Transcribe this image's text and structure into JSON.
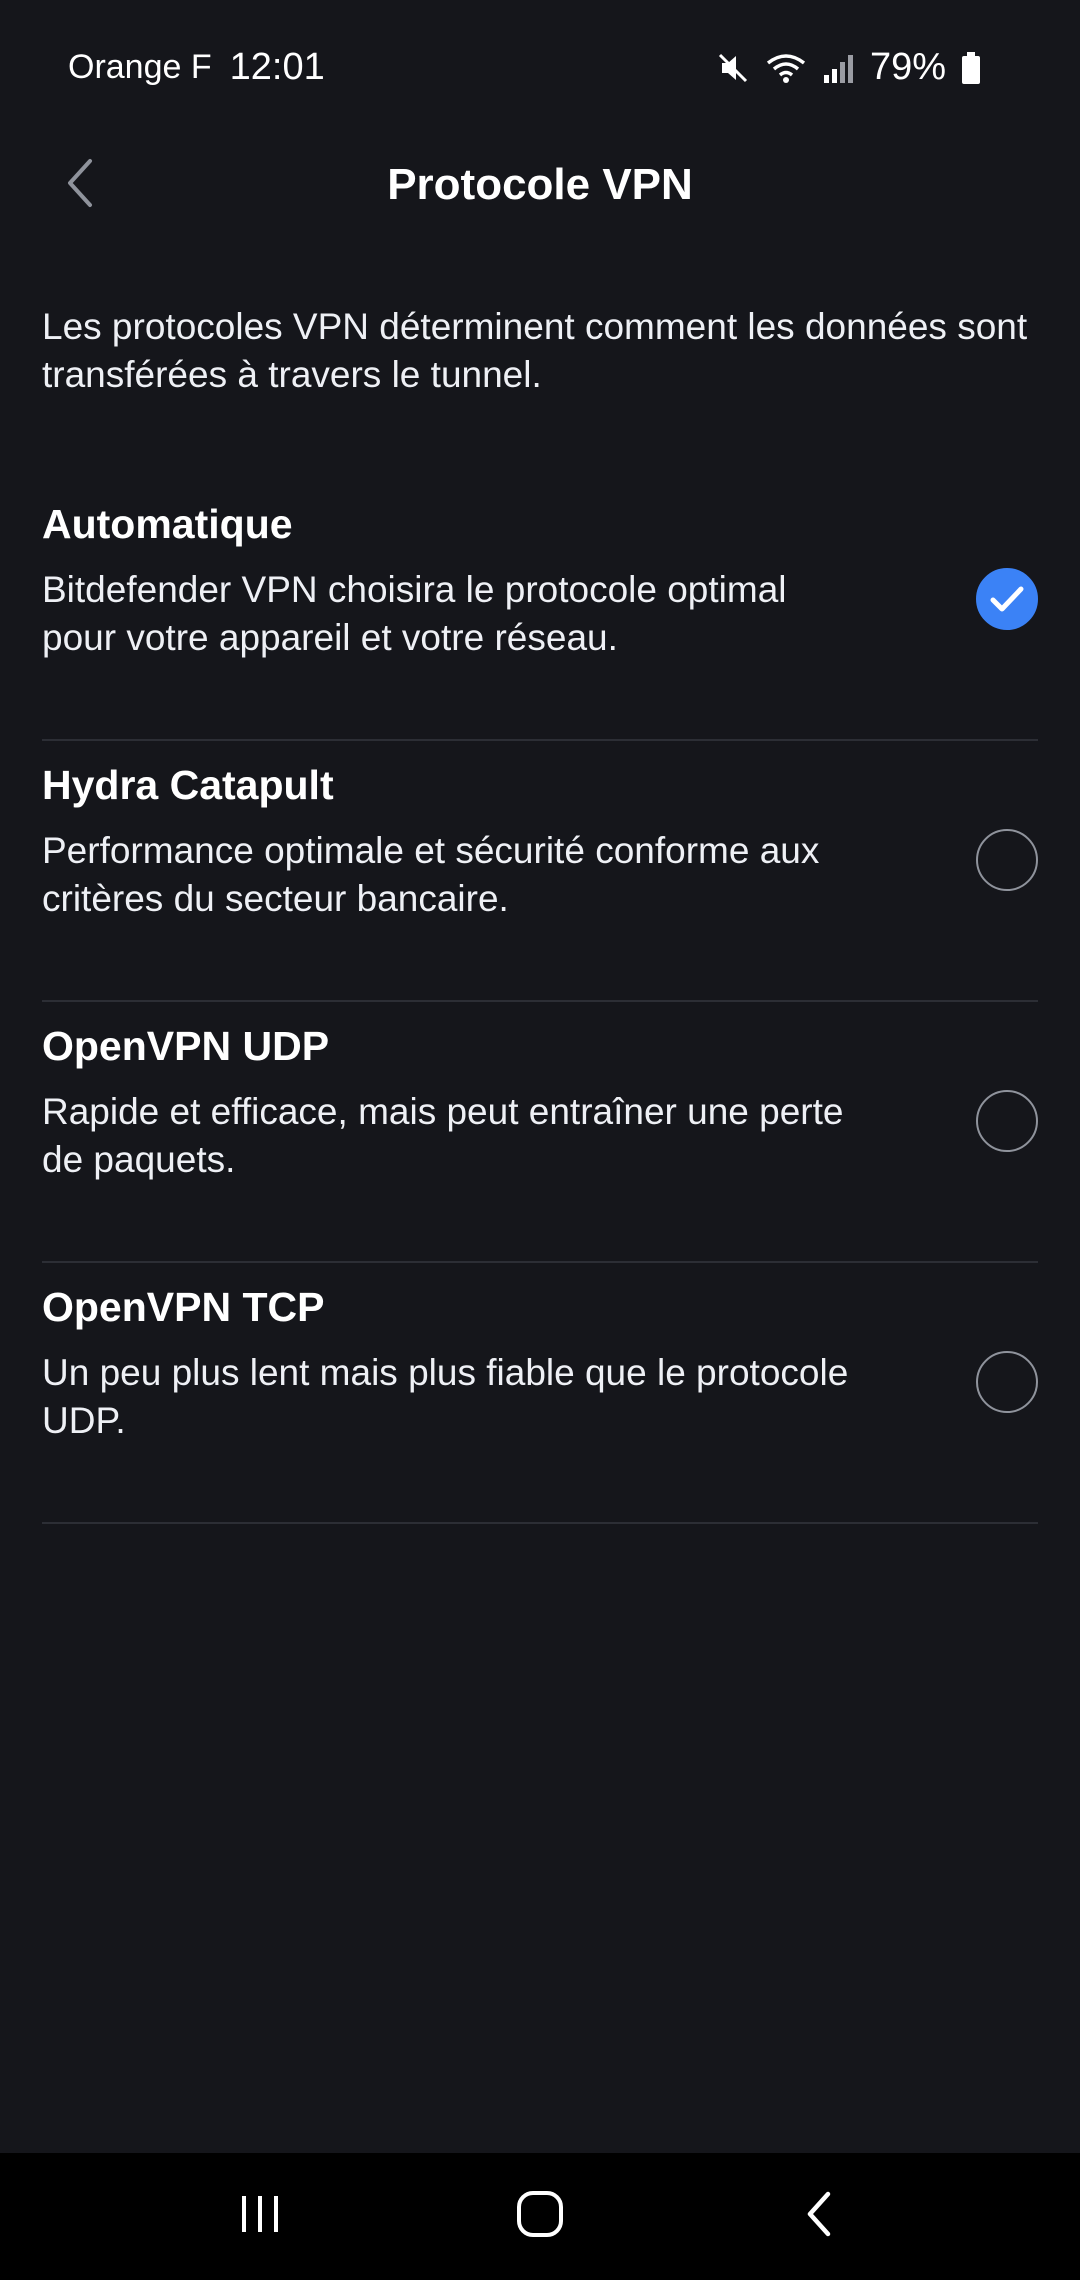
{
  "status_bar": {
    "carrier": "Orange F",
    "time": "12:01",
    "battery": "79%",
    "icons": [
      "mute-icon",
      "wifi-icon",
      "signal-icon",
      "battery-icon"
    ]
  },
  "app_bar": {
    "title": "Protocole VPN",
    "back_icon": "chevron-left-icon"
  },
  "description": "Les protocoles VPN déterminent comment les données sont transférées à travers le tunnel.",
  "options": [
    {
      "title": "Automatique",
      "description": "Bitdefender VPN choisira le protocole optimal pour votre appareil et votre réseau.",
      "selected": true
    },
    {
      "title": "Hydra Catapult",
      "description": "Performance optimale et sécurité conforme aux critères du secteur bancaire.",
      "selected": false
    },
    {
      "title": "OpenVPN UDP",
      "description": "Rapide et efficace, mais peut entraîner une perte de paquets.",
      "selected": false
    },
    {
      "title": "OpenVPN TCP",
      "description": "Un peu plus lent mais plus fiable que le protocole UDP.",
      "selected": false
    }
  ],
  "nav_bar": {
    "icons": [
      "recent-apps-icon",
      "home-icon",
      "back-icon"
    ]
  },
  "colors": {
    "background": "#15161b",
    "accent": "#3b82f6",
    "divider": "#2c2e35"
  }
}
